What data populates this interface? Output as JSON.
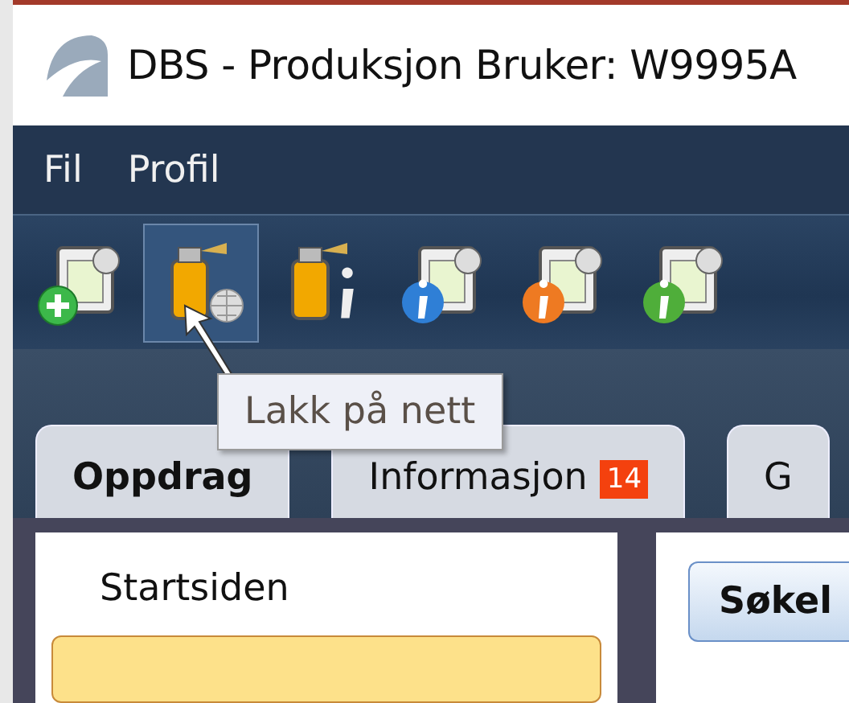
{
  "window": {
    "title": "DBS - Produksjon Bruker: W9995A"
  },
  "menu": [
    "Fil",
    "Profil"
  ],
  "toolbar": {
    "buttons": [
      {
        "kind": "doc-add",
        "selected": false
      },
      {
        "kind": "spray-globe",
        "selected": true
      },
      {
        "kind": "spray-info",
        "selected": false
      },
      {
        "kind": "doc-info",
        "selected": false,
        "color": "#2f7fd6"
      },
      {
        "kind": "doc-info",
        "selected": false,
        "color": "#ee7a22"
      },
      {
        "kind": "doc-info",
        "selected": false,
        "color": "#4fae3a"
      }
    ],
    "tooltip": "Lakk på nett"
  },
  "tabs": [
    {
      "label": "Oppdrag",
      "selected": true
    },
    {
      "label": "Informasjon",
      "selected": false,
      "badge": "14"
    },
    {
      "label": "G",
      "selected": false
    }
  ],
  "sidebar": {
    "items": [
      {
        "label": "Startsiden",
        "selected": false
      },
      {
        "selected": true
      }
    ]
  },
  "search_button": "Søkel"
}
